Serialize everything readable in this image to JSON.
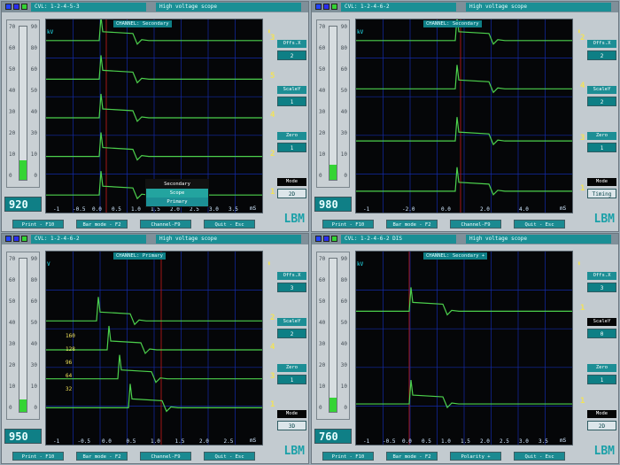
{
  "panels": [
    {
      "id": "p1",
      "title": "CVL: 1-2-4-5-3",
      "app": "High voltage scope",
      "channel": "Secondary",
      "readout": "920",
      "gauge": {
        "level": 0.13,
        "left": [
          70,
          60,
          50,
          40,
          30,
          20,
          10,
          0
        ],
        "right": [
          90,
          80,
          60,
          50,
          40,
          30,
          10,
          0
        ]
      },
      "controls": [
        "Offs.X",
        "2",
        "ScaleY",
        "1",
        "Zero",
        "1",
        "Mode",
        "2D"
      ],
      "btns": [
        "Print - F10",
        "Bar mode - F2",
        "Channel-F9",
        "Quit - Esc"
      ],
      "ticks": [
        "-1",
        "-0.5",
        "0.0",
        "0.5",
        "1.0",
        "1.5",
        "2.0",
        "2.5",
        "3.0",
        "3.5"
      ],
      "unit": "mS",
      "yunit": "kV",
      "bnums": [
        "3",
        "5",
        "4",
        "2",
        "1"
      ],
      "traces": [
        0.1,
        0.3,
        0.5,
        0.7,
        0.9
      ],
      "type": "2d",
      "menu": [
        "Secondary",
        "Scope",
        "Primary"
      ]
    },
    {
      "id": "p2",
      "title": "CVL: 1-2-4-6-2",
      "app": "High voltage scope",
      "channel": "Secondary",
      "readout": "980",
      "gauge": {
        "level": 0.1,
        "left": [
          70,
          60,
          50,
          40,
          30,
          20,
          10,
          0
        ],
        "right": [
          90,
          80,
          60,
          50,
          40,
          30,
          10,
          0
        ]
      },
      "controls": [
        "Offs.X",
        "2",
        "ScaleY",
        "2",
        "Zero",
        "1",
        "Mode",
        "Timing"
      ],
      "btns": [
        "Print - F10",
        "Bar mode - F2",
        "Channel-F9",
        "Quit - Esc"
      ],
      "ticks": [
        "-1",
        "-2.0",
        "0.0",
        "2.0",
        "4.0"
      ],
      "unit": "mS",
      "yunit": "kV",
      "bnums": [
        "2",
        "4",
        "3",
        "1"
      ],
      "traces": [
        0.1,
        0.35,
        0.62,
        0.88
      ],
      "type": "timing"
    },
    {
      "id": "p3",
      "title": "CVL: 1-2-4-6-2",
      "app": "High voltage scope",
      "channel": "Primary",
      "readout": "950",
      "gauge": {
        "level": 0.08,
        "left": [
          70,
          60,
          50,
          40,
          30,
          20,
          10,
          0
        ],
        "right": [
          90,
          80,
          60,
          50,
          40,
          30,
          10,
          0
        ]
      },
      "controls": [
        "Offs.X",
        "3",
        "ScaleY",
        "2",
        "Zero",
        "1",
        "Mode",
        "3D"
      ],
      "btns": [
        "Print - F10",
        "Bar mode - F2",
        "Channel-F9",
        "Quit - Esc"
      ],
      "ticks": [
        "-1",
        "-0.5",
        "0.0",
        "0.5",
        "1.0",
        "1.5",
        "2.0",
        "2.5"
      ],
      "unit": "mS",
      "yunit": "V",
      "bnums": [
        "2",
        "4",
        "3",
        "1"
      ],
      "traces": [
        0.35,
        0.5,
        0.65,
        0.8
      ],
      "type": "3d",
      "yaxis": [
        "160",
        "128",
        "96",
        "64",
        "32"
      ]
    },
    {
      "id": "p4",
      "title": "CVL: 1-2-4-6-2 DIS",
      "app": "High voltage scope",
      "channel": "Secondary +",
      "readout": "760",
      "gauge": {
        "level": 0.09,
        "left": [
          70,
          60,
          50,
          40,
          30,
          20,
          10,
          0
        ],
        "right": [
          90,
          80,
          60,
          50,
          40,
          30,
          10,
          0
        ]
      },
      "controls": [
        "Offs.X",
        "3",
        "ScaleY",
        "0",
        "Zero",
        "1",
        "Mode",
        "2D"
      ],
      "btns": [
        "Print - F10",
        "Bar mode - F2",
        "Polarity +",
        "Quit - Esc"
      ],
      "ticks": [
        "-1",
        "-0.5",
        "0.0",
        "0.5",
        "1.0",
        "1.5",
        "2.0",
        "2.5",
        "3.0",
        "3.5"
      ],
      "unit": "mS",
      "yunit": "kV",
      "bnums": [
        "1",
        "1"
      ],
      "traces": [
        0.3,
        0.78
      ],
      "type": "dis"
    }
  ],
  "brand": "LBM"
}
